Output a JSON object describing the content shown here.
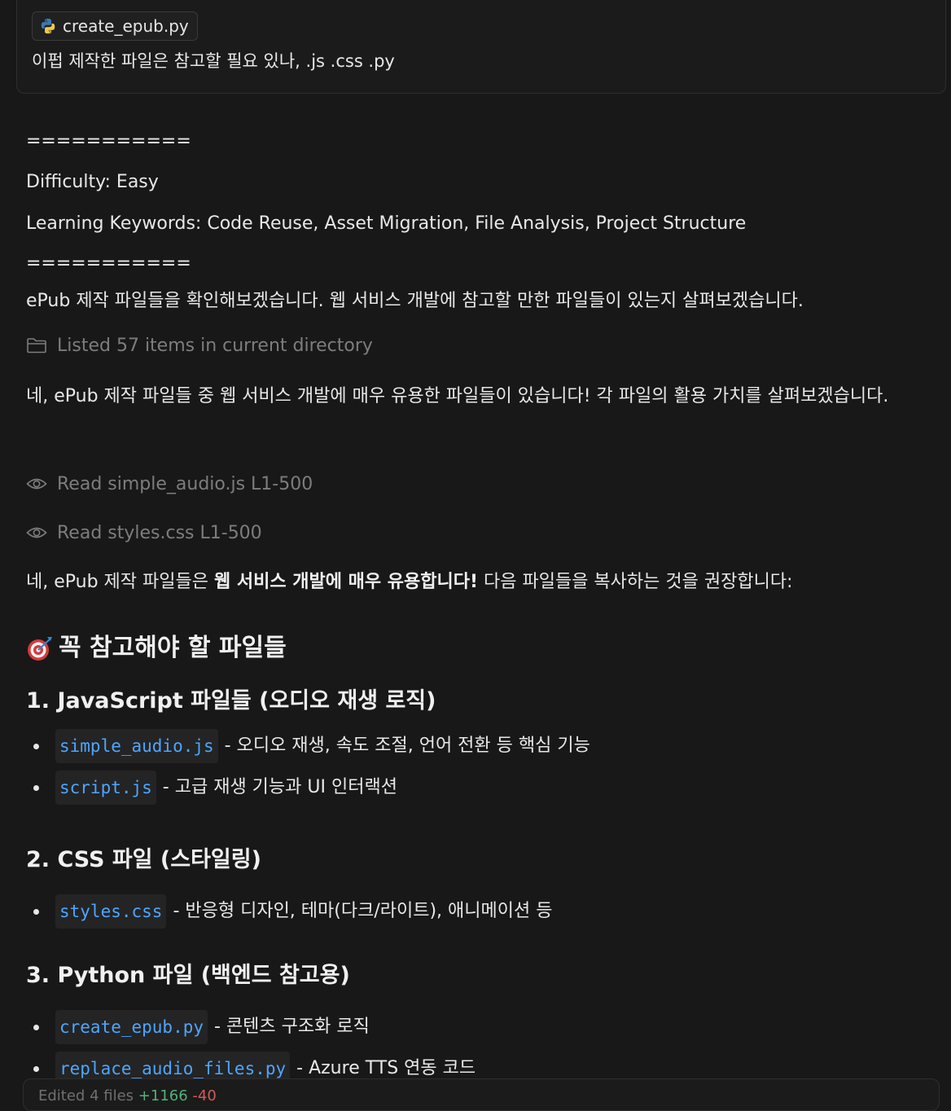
{
  "user_message": {
    "attachment": {
      "icon": "python-file-icon",
      "filename": "create_epub.py"
    },
    "text": "이펍 제작한 파일은 참고할 필요 있나, .js .css .py"
  },
  "response": {
    "separator_top": "===========",
    "difficulty": "Difficulty: Easy",
    "keywords": "Learning Keywords: Code Reuse, Asset Migration, File Analysis, Project Structure",
    "separator_bottom": "===========",
    "intro": "ePub 제작 파일들을 확인해보겠습니다. 웹 서비스 개발에 참고할 만한 파일들이 있는지 살펴보겠습니다.",
    "tool_list": {
      "icon": "folder-icon",
      "text": "Listed 57 items in current directory"
    },
    "analysis": "네, ePub 제작 파일들 중 웹 서비스 개발에 매우 유용한 파일들이 있습니다! 각 파일의 활용 가치를 살펴보겠습니다.",
    "tool_read_1": {
      "icon": "eye-icon",
      "text": "Read simple_audio.js L1-500"
    },
    "tool_read_2": {
      "icon": "eye-icon",
      "text": "Read styles.css L1-500"
    },
    "conclusion": {
      "prefix": "네, ePub 제작 파일들은 ",
      "bold": "웹 서비스 개발에 매우 유용합니다!",
      "suffix": " 다음 파일들을 복사하는 것을 권장합니다:"
    },
    "section_title": "꼭 참고해야 할 파일들",
    "section_icon": "target-icon",
    "groups": [
      {
        "title": "1. JavaScript 파일들 (오디오 재생 로직)",
        "items": [
          {
            "file": "simple_audio.js",
            "desc": "- 오디오 재생, 속도 조절, 언어 전환 등 핵심 기능"
          },
          {
            "file": "script.js",
            "desc": "- 고급 재생 기능과 UI 인터랙션"
          }
        ]
      },
      {
        "title": "2. CSS 파일 (스타일링)",
        "items": [
          {
            "file": "styles.css",
            "desc": "- 반응형 디자인, 테마(다크/라이트), 애니메이션 등"
          }
        ]
      },
      {
        "title": "3. Python 파일 (백엔드 참고용)",
        "items": [
          {
            "file": "create_epub.py",
            "desc": "- 콘텐츠 구조화 로직"
          },
          {
            "file": "replace_audio_files.py",
            "desc": "- Azure TTS 연동 코드"
          }
        ]
      }
    ]
  },
  "bottom_bar": {
    "label": "Edited 4 files",
    "added": "+1166",
    "removed": "-40"
  },
  "colors": {
    "background": "#181818",
    "code_text": "#4ea6ff",
    "muted": "#7d7d7d"
  }
}
